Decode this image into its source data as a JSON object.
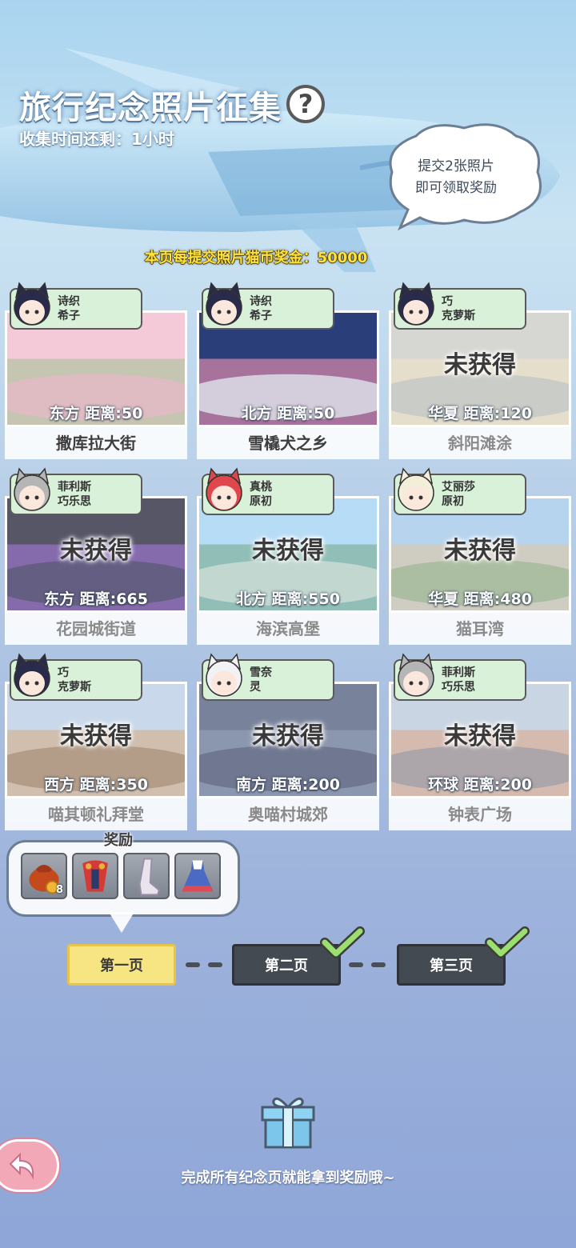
{
  "header": {
    "title": "旅行纪念照片征集",
    "help_icon": "?",
    "timer": "收集时间还剩：1小时"
  },
  "bubble": {
    "line1": "提交2张照片",
    "line2": "即可领取奖励"
  },
  "bonus_text": "本页每提交照片猫币奖金：50000",
  "cards": [
    {
      "char_line1": "诗织",
      "char_line2": "希子",
      "status": "",
      "dist": "东方  距离:50",
      "name": "撒库拉大街",
      "obtained": true
    },
    {
      "char_line1": "诗织",
      "char_line2": "希子",
      "status": "",
      "dist": "北方  距离:50",
      "name": "雪橇犬之乡",
      "obtained": true
    },
    {
      "char_line1": "巧",
      "char_line2": "克萝斯",
      "status": "未获得",
      "dist": "华夏  距离:120",
      "name": "斜阳滩涂",
      "obtained": false
    },
    {
      "char_line1": "菲利斯",
      "char_line2": "巧乐思",
      "status": "未获得",
      "dist": "东方  距离:665",
      "name": "花园城街道",
      "obtained": false
    },
    {
      "char_line1": "真桃",
      "char_line2": "原初",
      "status": "未获得",
      "dist": "北方  距离:550",
      "name": "海滨高堡",
      "obtained": false
    },
    {
      "char_line1": "艾丽莎",
      "char_line2": "原初",
      "status": "未获得",
      "dist": "华夏  距离:480",
      "name": "猫耳湾",
      "obtained": false
    },
    {
      "char_line1": "巧",
      "char_line2": "克萝斯",
      "status": "未获得",
      "dist": "西方  距离:350",
      "name": "喵其顿礼拜堂",
      "obtained": false
    },
    {
      "char_line1": "雪奈",
      "char_line2": "灵",
      "status": "未获得",
      "dist": "南方  距离:200",
      "name": "奥喵村城郊",
      "obtained": false
    },
    {
      "char_line1": "菲利斯",
      "char_line2": "巧乐思",
      "status": "未获得",
      "dist": "环球  距离:200",
      "name": "钟表广场",
      "obtained": false
    }
  ],
  "rewards": {
    "label": "奖励",
    "items": [
      {
        "icon": "coin-bag-icon",
        "count": "8"
      },
      {
        "icon": "red-cape-icon",
        "count": ""
      },
      {
        "icon": "boot-icon",
        "count": ""
      },
      {
        "icon": "dress-icon",
        "count": ""
      }
    ]
  },
  "pages": [
    {
      "label": "第一页",
      "state": "active"
    },
    {
      "label": "第二页",
      "state": "done"
    },
    {
      "label": "第三页",
      "state": "done"
    }
  ],
  "footer": {
    "gift_icon": "gift-box-icon",
    "text": "完成所有纪念页就能拿到奖励哦~",
    "back_icon": "back-arrow-icon"
  },
  "colors": {
    "active_page": "#f7e583",
    "done_page": "#444a52",
    "check_green": "#9be06f",
    "bonus_yellow": "#ffe23a",
    "tag_green": "#d9f1d9"
  }
}
